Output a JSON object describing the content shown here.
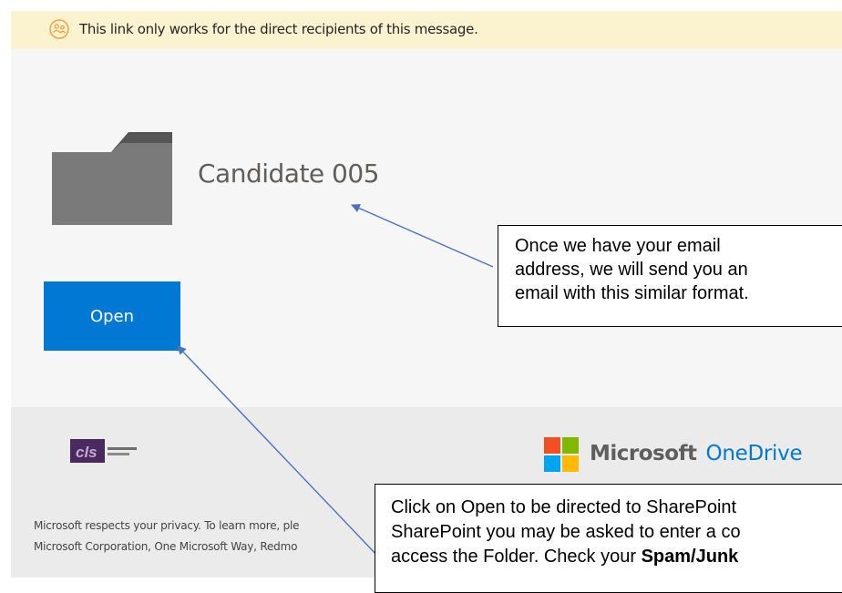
{
  "banner": {
    "icon": "people-link-icon",
    "text": "This link only works for the direct recipients of this message."
  },
  "item": {
    "icon": "folder-icon",
    "name": "Candidate 005"
  },
  "open_button": {
    "label": "Open"
  },
  "footer": {
    "org_logo": "cls-logo",
    "brand_icon": "microsoft-logo-icon",
    "brand_microsoft": "Microsoft",
    "brand_product": "OneDrive",
    "privacy_line1": "Microsoft respects your privacy. To learn more, ple",
    "privacy_line2": "Microsoft Corporation, One Microsoft Way, Redmo"
  },
  "callouts": [
    {
      "lines": [
        "Once we have your email",
        "address, we will send you an",
        "email with this similar format."
      ]
    },
    {
      "line1": "Click on Open to be directed to SharePoint",
      "line2": "SharePoint you may be asked to enter a co",
      "line3_before": "access the Folder. Check your ",
      "line3_bold": "Spam/Junk"
    }
  ],
  "colors": {
    "banner_bg": "#fbf3cf",
    "banner_icon": "#f39c3d",
    "main_bg": "#f6f6f6",
    "footer_bg": "#ebebeb",
    "accent": "#0078d4",
    "folder": "#7a7a7a",
    "arrow": "#4a72c4"
  }
}
